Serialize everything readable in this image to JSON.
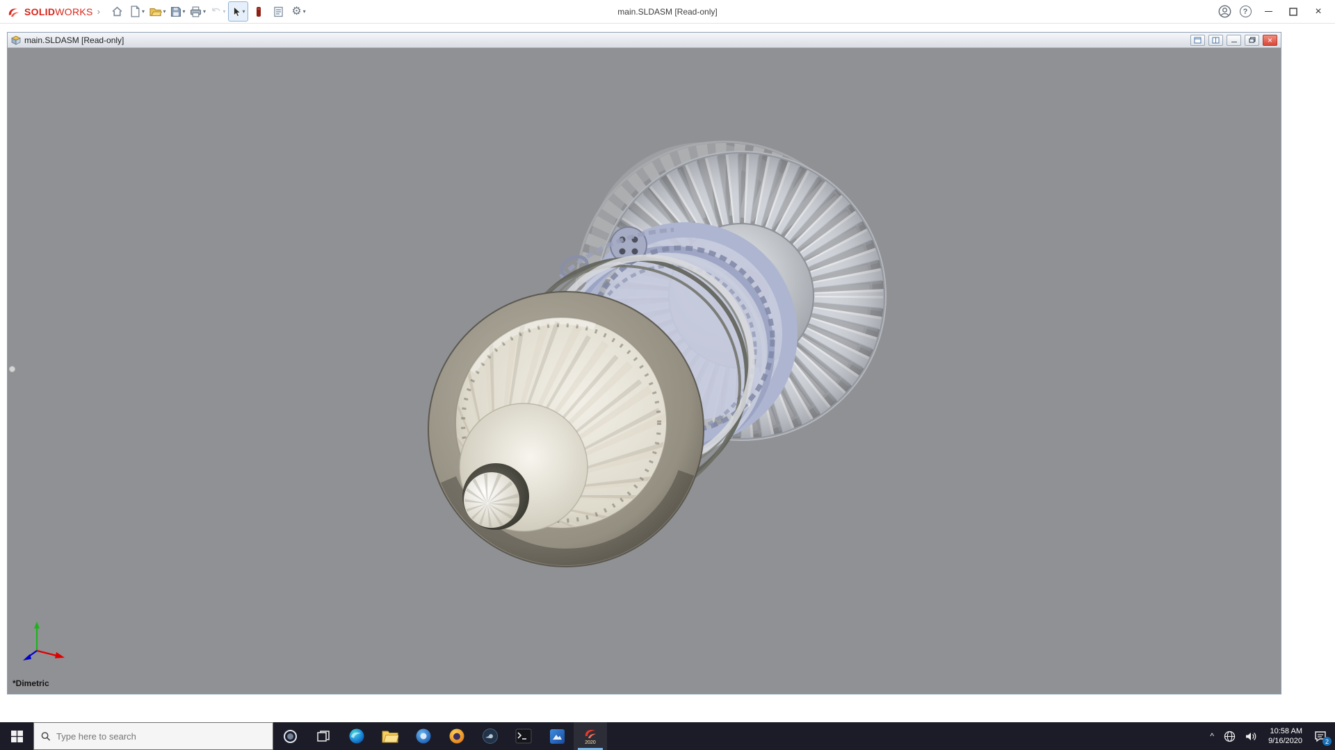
{
  "app_titlebar": {
    "brand_primary": "SOLID",
    "brand_secondary": "WORKS",
    "center_title": "main.SLDASM [Read-only]"
  },
  "document_window": {
    "title": "main.SLDASM [Read-only]",
    "view_orientation": "*Dimetric"
  },
  "taskbar": {
    "search_placeholder": "Type here to search",
    "solidworks_icon_year": "2020",
    "clock_time": "10:58 AM",
    "clock_date": "9/16/2020",
    "notification_badge": "2"
  },
  "icons": {
    "glyphs": {
      "caret": "▾",
      "menu_expand": "›",
      "gear": "⚙",
      "help": "?",
      "close": "×",
      "tray_up": "^"
    },
    "toolbar": [
      "home-icon",
      "new-document-icon",
      "open-icon",
      "save-icon",
      "print-icon",
      "undo-icon",
      "select-arrow-icon",
      "red-tool-icon",
      "file-properties-icon",
      "options-gear-icon"
    ],
    "titlebar_right": [
      "account-icon",
      "help-icon",
      "minimize-icon",
      "restore-icon",
      "close-icon"
    ],
    "taskbar": [
      "start-icon",
      "search-icon",
      "cortana-icon",
      "task-view-icon",
      "edge-icon",
      "file-explorer-icon",
      "blue-circle-app-icon",
      "orange-circle-app-icon",
      "dark-circle-app-icon",
      "terminal-app-icon",
      "blue-square-app-icon",
      "solidworks-app-icon",
      "tray-expand-icon",
      "network-icon",
      "volume-icon",
      "action-center-icon"
    ]
  },
  "colors": {
    "brand_red": "#d8251a",
    "viewport_bg": "#909194",
    "taskbar_bg": "#1c1c28",
    "doc_close_red": "#d8473a",
    "active_app_underline": "#76b9ed"
  }
}
